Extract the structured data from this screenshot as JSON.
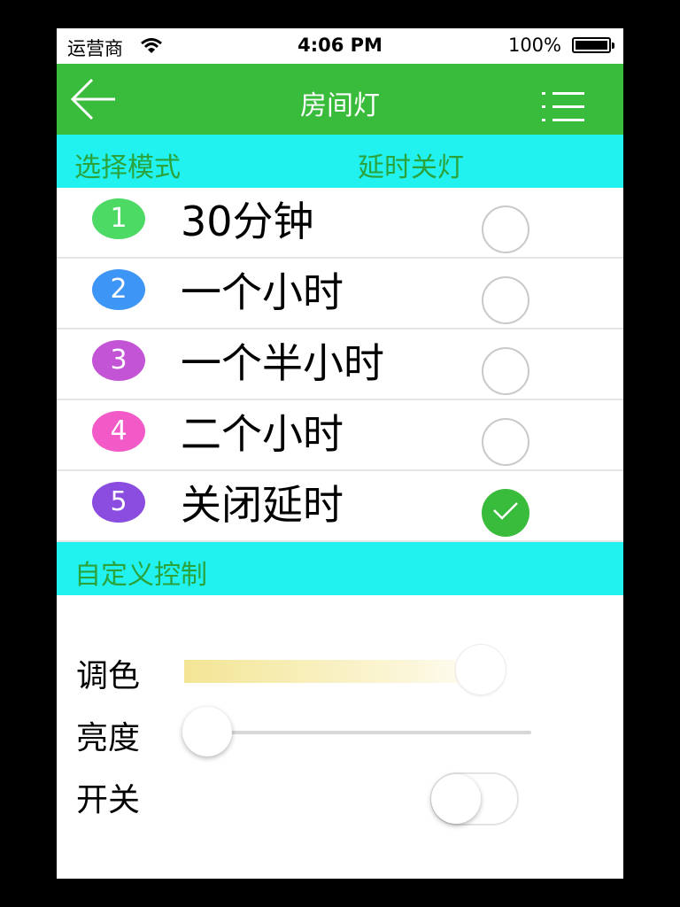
{
  "status_bar": {
    "carrier": "运营商",
    "time": "4:06 PM",
    "battery": "100%"
  },
  "nav": {
    "title": "房间灯",
    "back_icon": "back-arrow-icon",
    "menu_icon": "list-menu-icon"
  },
  "mode_section": {
    "label": "选择模式",
    "value": "延时关灯"
  },
  "options": [
    {
      "number": "1",
      "label": "30分钟",
      "color": "#4cd964",
      "checked": false
    },
    {
      "number": "2",
      "label": "一个小时",
      "color": "#3d95f5",
      "checked": false
    },
    {
      "number": "3",
      "label": "一个半小时",
      "color": "#c354d6",
      "checked": false
    },
    {
      "number": "4",
      "label": "二个小时",
      "color": "#f15ac7",
      "checked": false
    },
    {
      "number": "5",
      "label": "关闭延时",
      "color": "#8a4de0",
      "checked": true
    }
  ],
  "custom_section": {
    "label": "自定义控制"
  },
  "controls": {
    "color_label": "调色",
    "brightness_label": "亮度",
    "power_label": "开关",
    "color_value": 0.93,
    "brightness_value": 0.0,
    "power_on": false
  },
  "colors": {
    "nav_green": "#39bb3b",
    "section_cyan": "#21f2ef",
    "section_text": "#2aa33c"
  }
}
